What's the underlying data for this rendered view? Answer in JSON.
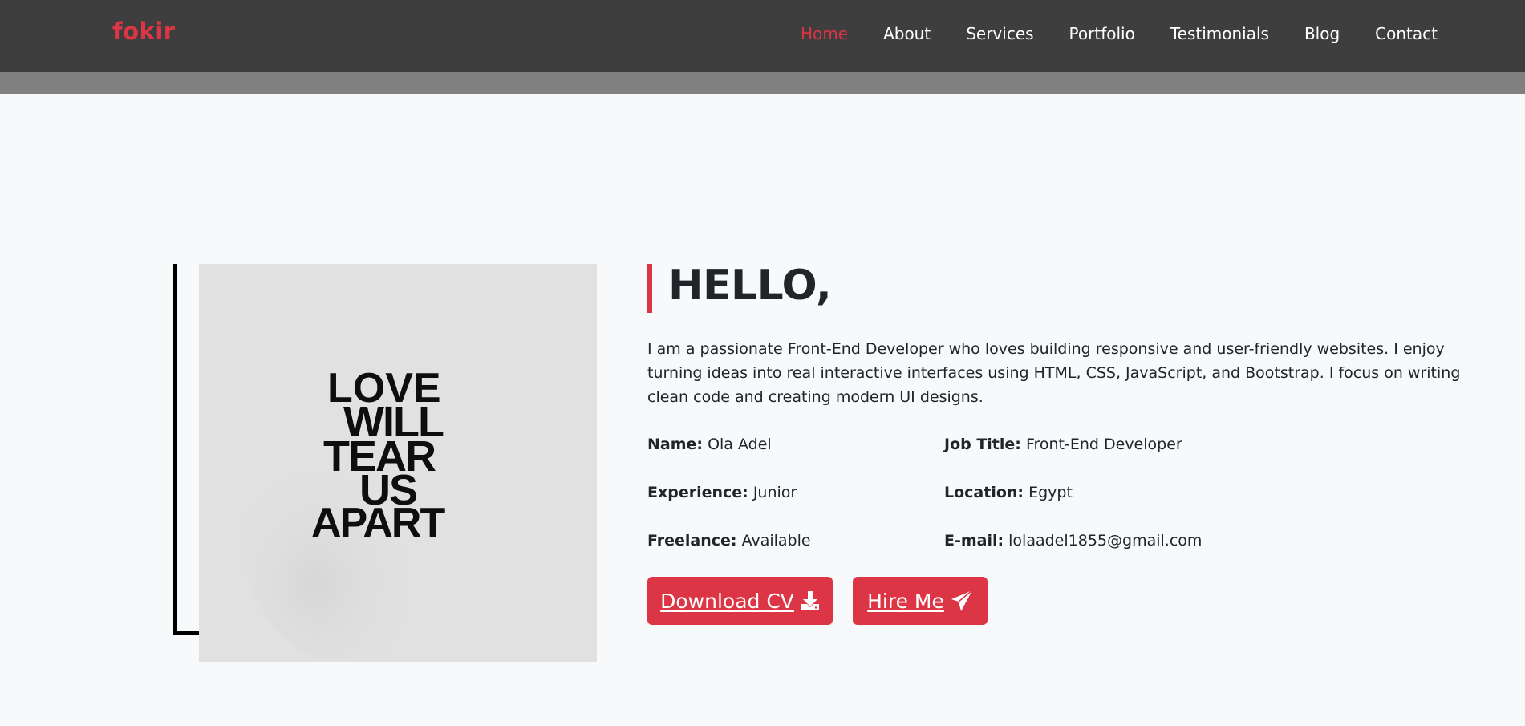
{
  "nav": {
    "brand": "fokir",
    "links": [
      {
        "label": "Home",
        "active": true
      },
      {
        "label": "About"
      },
      {
        "label": "Services"
      },
      {
        "label": "Portfolio"
      },
      {
        "label": "Testimonials"
      },
      {
        "label": "Blog"
      },
      {
        "label": "Contact"
      }
    ]
  },
  "about": {
    "heading": "HELLO,",
    "bio": "I am a passionate Front-End Developer who loves building responsive and user-friendly websites. I enjoy turning ideas into real interactive interfaces using HTML, CSS, JavaScript, and Bootstrap. I focus on writing clean code and creating modern UI designs.",
    "info": [
      {
        "label": "Name:",
        "value": "Ola Adel"
      },
      {
        "label": "Job Title:",
        "value": "Front-End Developer"
      },
      {
        "label": "Experience:",
        "value": "Junior"
      },
      {
        "label": "Location:",
        "value": "Egypt"
      },
      {
        "label": "Freelance:",
        "value": "Available"
      },
      {
        "label": "E-mail:",
        "value": "lolaadel1855@gmail.com"
      }
    ],
    "buttons": {
      "download_cv": "Download CV",
      "hire_me": "Hire Me"
    },
    "photo_text": [
      "LOVE",
      "WILL",
      "TEAR",
      "US",
      "APART"
    ]
  },
  "colors": {
    "accent": "#dc3545",
    "navbar": "#3e3e3e",
    "strip": "#808080",
    "background": "#f8f9fa"
  },
  "icons": {
    "download": "download-icon",
    "hire": "paper-plane-icon"
  }
}
